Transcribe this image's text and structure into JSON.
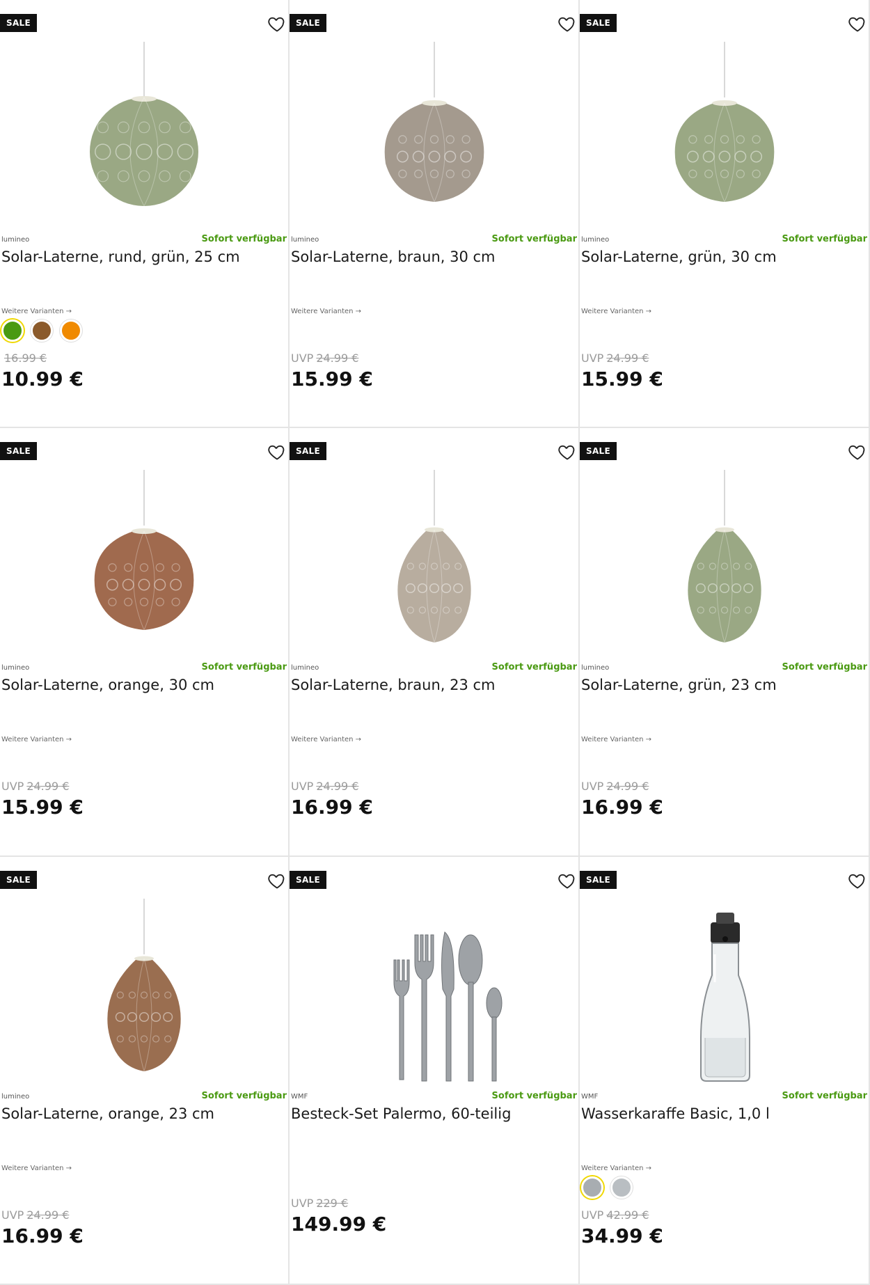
{
  "colors": {
    "sale_badge_bg": "#111111",
    "availability": "#4a9a12",
    "old_price": "#9a9a9a"
  },
  "products": [
    {
      "badge": "SALE",
      "brand": "lumineo",
      "availability": "Sofort verfügbar",
      "title": "Solar-Laterne, rund, grün, 25 cm",
      "variants_label": "Weitere Varianten →",
      "swatches": [
        {
          "color": "#4a9a12",
          "selected": true
        },
        {
          "color": "#8b5a2b",
          "selected": false
        },
        {
          "color": "#f08a00",
          "selected": false
        }
      ],
      "uvp_label": "",
      "old_price": "16.99 €",
      "price": "10.99 €",
      "image": {
        "type": "lantern-round",
        "fill": "#9aa884"
      }
    },
    {
      "badge": "SALE",
      "brand": "lumineo",
      "availability": "Sofort verfügbar",
      "title": "Solar-Laterne, braun, 30 cm",
      "variants_label": "Weitere Varianten →",
      "swatches": [],
      "uvp_label": "UVP",
      "old_price": "24.99 €",
      "price": "15.99 €",
      "image": {
        "type": "lantern-bell",
        "fill": "#a49a8e"
      }
    },
    {
      "badge": "SALE",
      "brand": "lumineo",
      "availability": "Sofort verfügbar",
      "title": "Solar-Laterne, grün, 30 cm",
      "variants_label": "Weitere Varianten →",
      "swatches": [],
      "uvp_label": "UVP",
      "old_price": "24.99 €",
      "price": "15.99 €",
      "image": {
        "type": "lantern-bell",
        "fill": "#9aa884"
      }
    },
    {
      "badge": "SALE",
      "brand": "lumineo",
      "availability": "Sofort verfügbar",
      "title": "Solar-Laterne, orange, 30 cm",
      "variants_label": "Weitere Varianten →",
      "swatches": [],
      "uvp_label": "UVP",
      "old_price": "24.99 €",
      "price": "15.99 €",
      "image": {
        "type": "lantern-bell",
        "fill": "#a06a4e"
      }
    },
    {
      "badge": "SALE",
      "brand": "lumineo",
      "availability": "Sofort verfügbar",
      "title": "Solar-Laterne, braun, 23 cm",
      "variants_label": "Weitere Varianten →",
      "swatches": [],
      "uvp_label": "UVP",
      "old_price": "24.99 €",
      "price": "16.99 €",
      "image": {
        "type": "lantern-oval",
        "fill": "#b8ad9f"
      }
    },
    {
      "badge": "SALE",
      "brand": "lumineo",
      "availability": "Sofort verfügbar",
      "title": "Solar-Laterne, grün, 23 cm",
      "variants_label": "Weitere Varianten →",
      "swatches": [],
      "uvp_label": "UVP",
      "old_price": "24.99 €",
      "price": "16.99 €",
      "image": {
        "type": "lantern-oval",
        "fill": "#9aa884"
      }
    },
    {
      "badge": "SALE",
      "brand": "lumineo",
      "availability": "Sofort verfügbar",
      "title": "Solar-Laterne, orange, 23 cm",
      "variants_label": "Weitere Varianten →",
      "swatches": [],
      "uvp_label": "UVP",
      "old_price": "24.99 €",
      "price": "16.99 €",
      "image": {
        "type": "lantern-oval",
        "fill": "#9a6e50"
      }
    },
    {
      "badge": "SALE",
      "brand": "WMF",
      "availability": "Sofort verfügbar",
      "title": "Besteck-Set Palermo, 60-teilig",
      "variants_label": "",
      "swatches": [],
      "uvp_label": "UVP",
      "old_price": "229 €",
      "price": "149.99 €",
      "image": {
        "type": "cutlery",
        "fill": "#9ea2a6"
      }
    },
    {
      "badge": "SALE",
      "brand": "WMF",
      "availability": "Sofort verfügbar",
      "title": "Wasserkaraffe Basic, 1,0 l",
      "variants_label": "Weitere Varianten →",
      "swatches": [
        {
          "color": "#a8adb1",
          "selected": true
        },
        {
          "color": "#b9bec2",
          "selected": false
        }
      ],
      "uvp_label": "UVP",
      "old_price": "42.99 €",
      "price": "34.99 €",
      "image": {
        "type": "carafe",
        "fill": "#2a2a2a"
      }
    }
  ]
}
